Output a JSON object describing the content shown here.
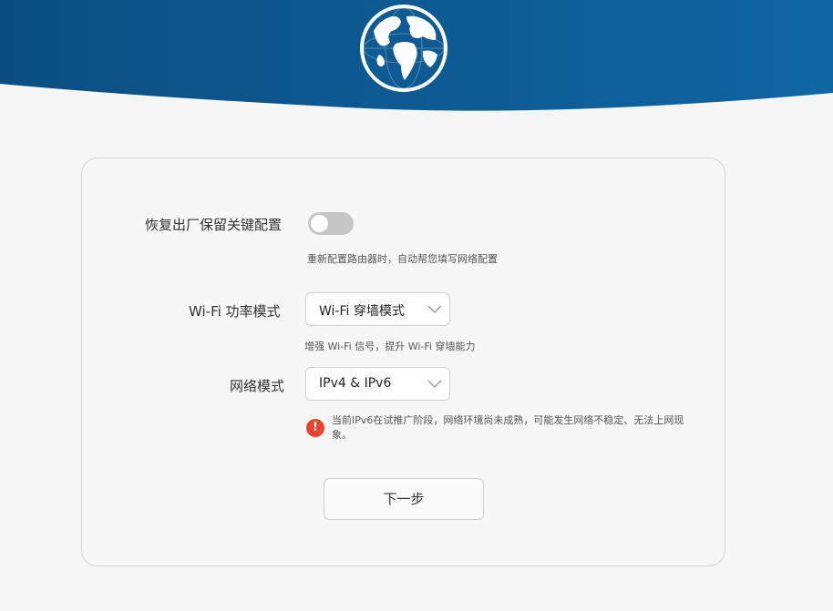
{
  "header": {
    "logo_icon": "globe-icon",
    "brand_color": "#0e5a93"
  },
  "form": {
    "restore": {
      "label": "恢复出厂保留关键配置",
      "hint": "重新配置路由器时，自动帮您填写网络配置",
      "enabled": false
    },
    "wifi_power": {
      "label": "Wi-Fi 功率模式",
      "value": "Wi-Fi 穿墙模式",
      "hint": "增强 Wi-Fi 信号，提升 Wi-Fi 穿墙能力"
    },
    "network_mode": {
      "label": "网络模式",
      "value": "IPv4 & IPv6",
      "warning_icon": "exclamation-icon",
      "warning": "当前IPv6在试推广阶段，网络环境尚未成熟，可能发生网络不稳定、无法上网现象。",
      "warning_color": "#e8452c"
    },
    "next_label": "下一步"
  }
}
